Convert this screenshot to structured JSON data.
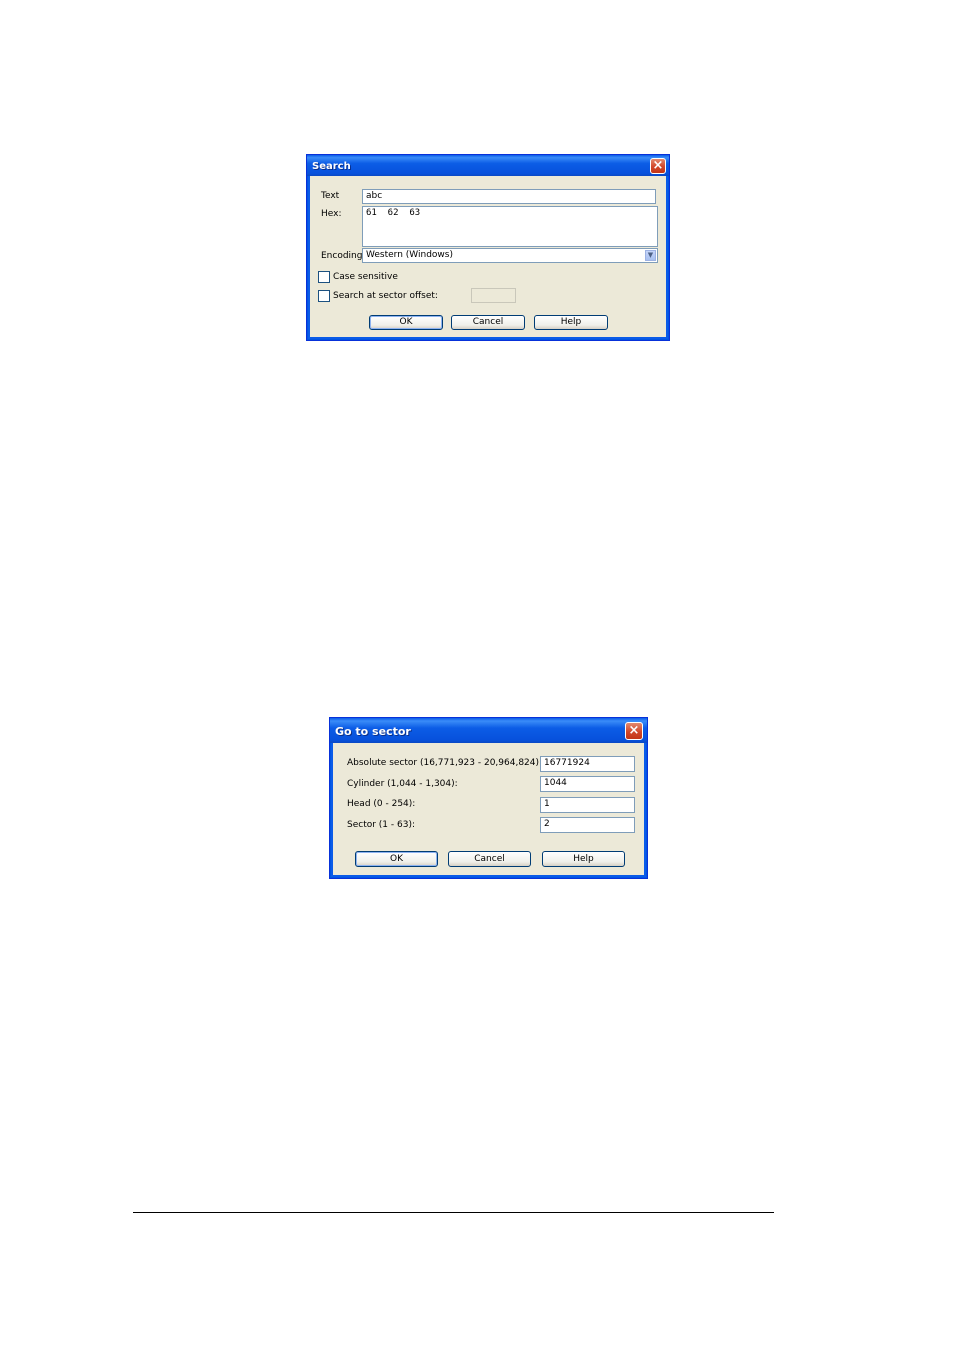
{
  "search_dialog": {
    "title": "Search",
    "text_label": "Text",
    "text_value": "abc",
    "hex_label": "Hex:",
    "hex_value": "61  62  63",
    "encoding_label": "Encoding:",
    "encoding_value": "Western (Windows)",
    "case_label": "Case sensitive",
    "case_checked": false,
    "offset_label": "Search at sector offset:",
    "offset_checked": false,
    "offset_value": "",
    "ok_label": "OK",
    "cancel_label": "Cancel",
    "help_label": "Help"
  },
  "goto_dialog": {
    "title": "Go to sector",
    "absolute_label": "Absolute sector (16,771,923 - 20,964,824):",
    "absolute_value": "16771924",
    "cylinder_label": "Cylinder (1,044 - 1,304):",
    "cylinder_value": "1044",
    "head_label": "Head (0 - 254):",
    "head_value": "1",
    "sector_label": "Sector (1 - 63):",
    "sector_value": "2",
    "ok_label": "OK",
    "cancel_label": "Cancel",
    "help_label": "Help"
  },
  "colors": {
    "titlebar": "#0a5ce8",
    "dialog_bg": "#ece9d8",
    "close_button": "#d2472a"
  },
  "icons": {
    "close": "close-icon",
    "dropdown": "chevron-down-icon"
  }
}
